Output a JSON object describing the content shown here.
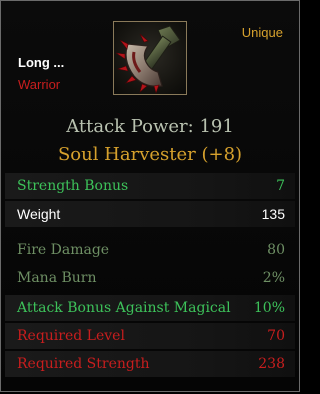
{
  "item": {
    "rarity": "Unique",
    "short_name": "Long ...",
    "class_requirement": "Warrior",
    "icon": "axe-icon",
    "attack_power": "Attack Power: 191",
    "title": "Soul Harvester (+8)"
  },
  "stats": {
    "strength_bonus": {
      "label": "Strength Bonus",
      "value": "7"
    },
    "weight": {
      "label": "Weight",
      "value": "135"
    },
    "fire_damage": {
      "label": "Fire Damage",
      "value": "80"
    },
    "mana_burn": {
      "label": "Mana Burn",
      "value": "2%"
    },
    "attack_bonus_magical": {
      "label": "Attack Bonus Against Magical",
      "value": "10%"
    },
    "required_level": {
      "label": "Required Level",
      "value": "70"
    },
    "required_strength": {
      "label": "Required Strength",
      "value": "238"
    }
  },
  "colors": {
    "unique": "#d6a12d",
    "bonus": "#3dc25a",
    "requirement_unmet": "#c81e1e",
    "muted_stat": "#6e8f64"
  }
}
